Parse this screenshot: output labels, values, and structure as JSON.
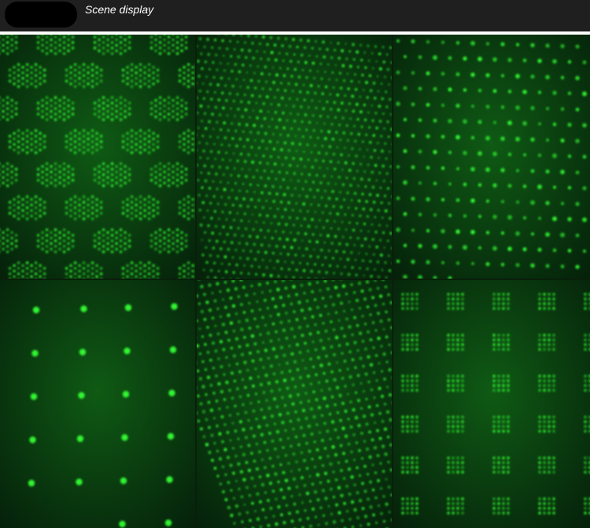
{
  "header": {
    "title": "Scene display"
  },
  "colors": {
    "header_bg": "#1f1f1f",
    "laser_green": "#33ff33",
    "panel_bg": "#0b3a10"
  },
  "panels": [
    {
      "id": "p1",
      "pattern": "diamond-cluster"
    },
    {
      "id": "p2",
      "pattern": "dense-dots"
    },
    {
      "id": "p3",
      "pattern": "sparse-dots"
    },
    {
      "id": "p4",
      "pattern": "large-grid-dots"
    },
    {
      "id": "p5",
      "pattern": "dense-dots-oblique"
    },
    {
      "id": "p6",
      "pattern": "square-cluster"
    }
  ]
}
